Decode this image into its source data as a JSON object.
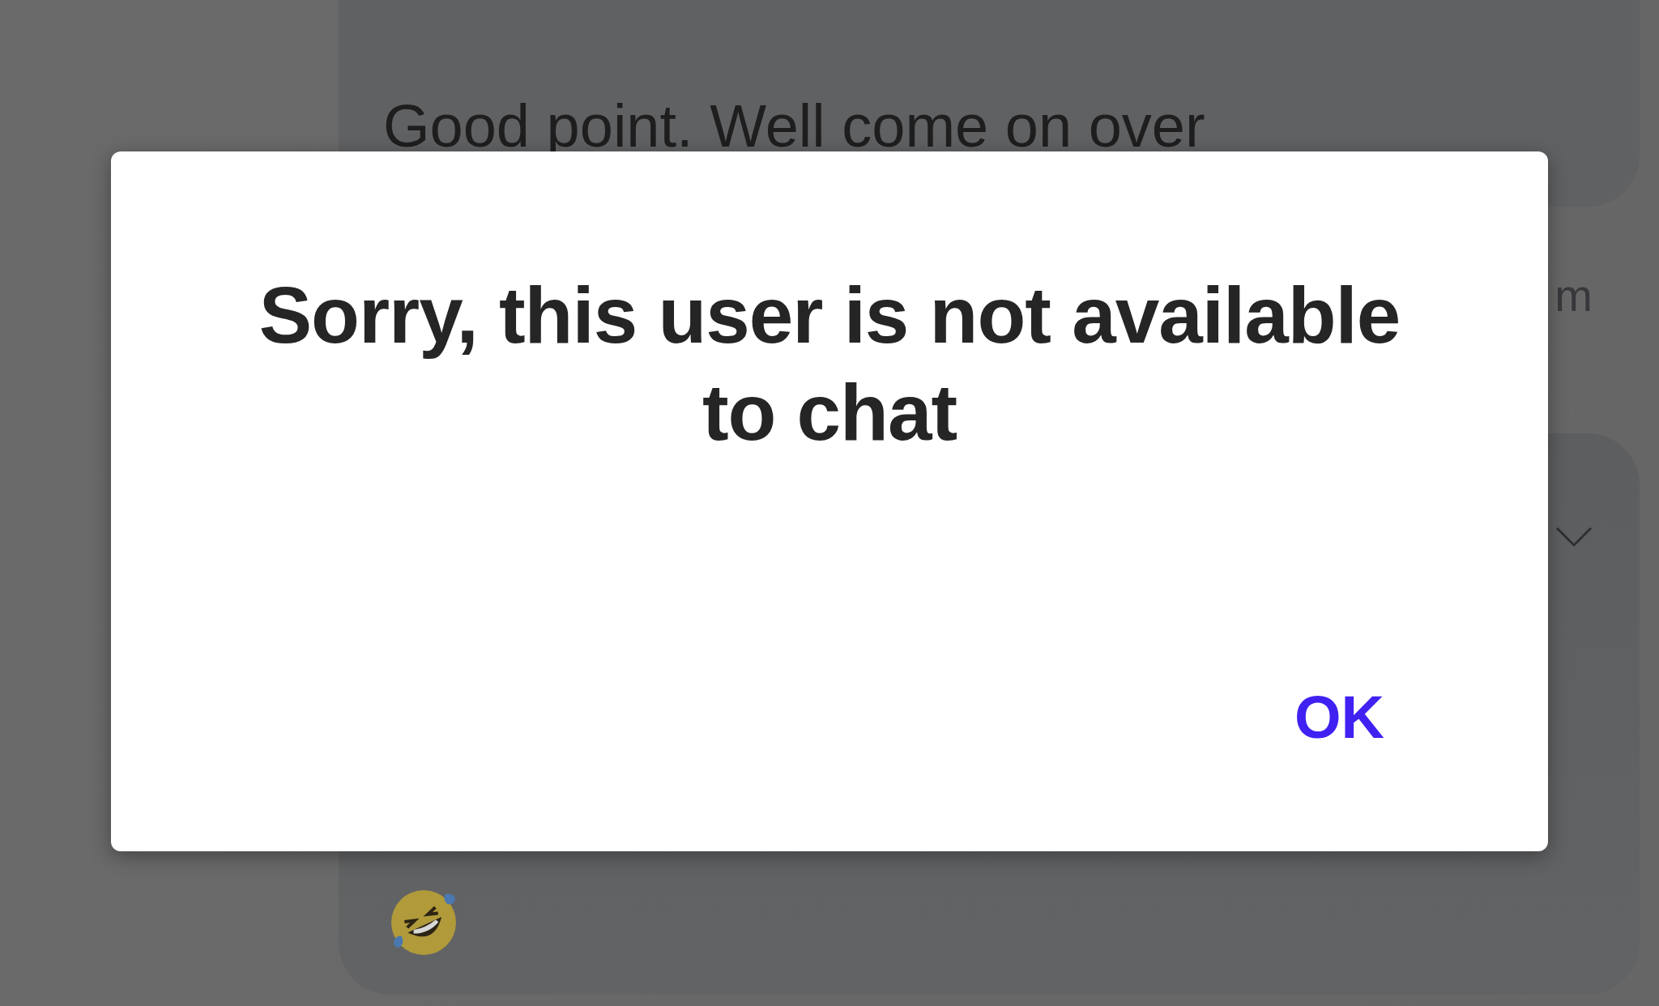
{
  "chat": {
    "messages": [
      {
        "kind": "text",
        "text": "Good point. Well come on over"
      },
      {
        "kind": "time",
        "text": "m"
      },
      {
        "kind": "emoji_bubble"
      }
    ]
  },
  "dialog": {
    "title": "Sorry, this user is not available to chat",
    "buttons": [
      {
        "label": "OK"
      }
    ]
  }
}
